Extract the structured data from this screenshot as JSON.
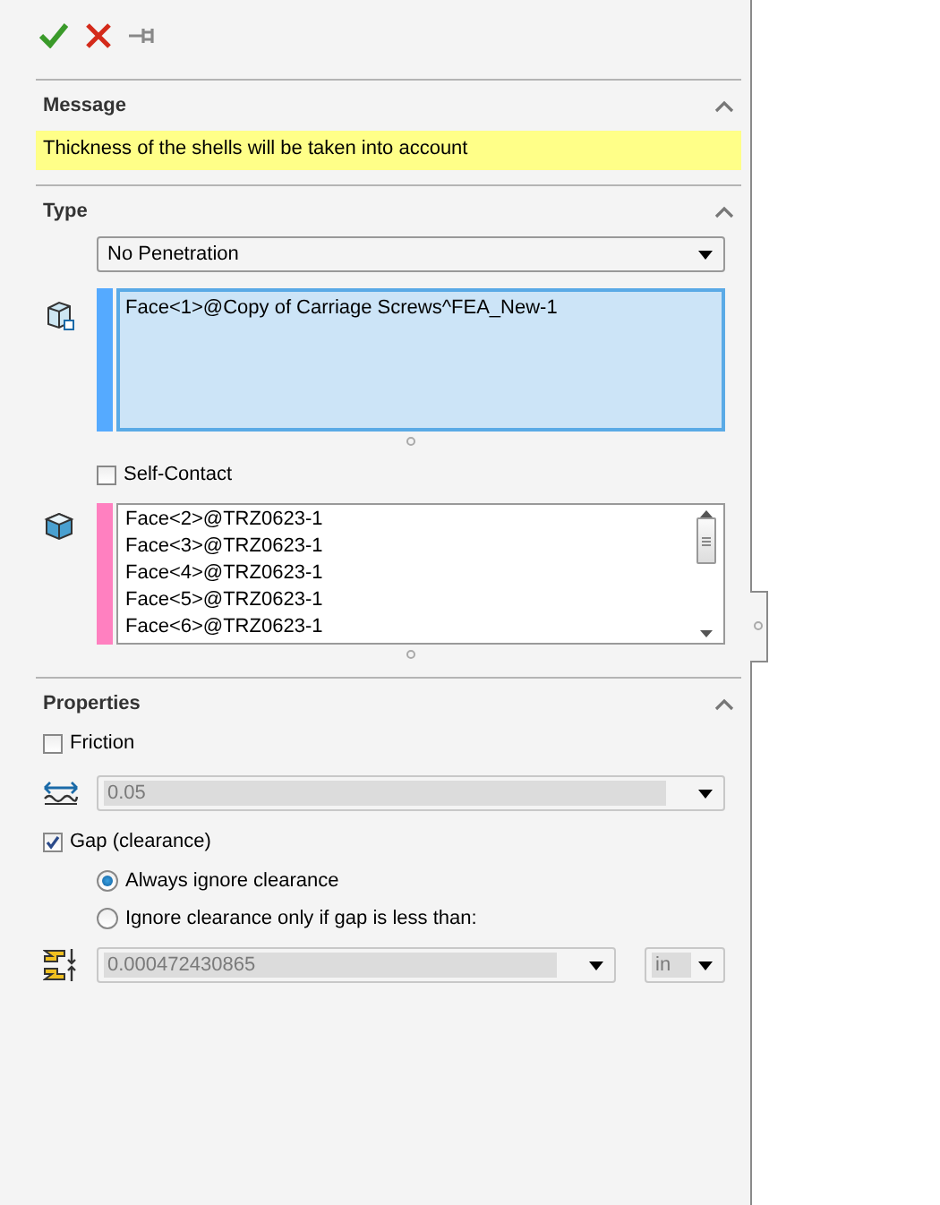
{
  "message": {
    "title": "Message",
    "expanded": true,
    "text": "Thickness of the shells will be taken into account"
  },
  "type": {
    "title": "Type",
    "expanded": true,
    "contact_type": "No Penetration",
    "selection_sets": [
      {
        "color": "#55aaff",
        "focused": true,
        "items": [
          "Face<1>@Copy of Carriage Screws^FEA_New-1"
        ]
      },
      {
        "color": "#ff80c0",
        "focused": false,
        "items": [
          "Face<2>@TRZ0623-1",
          "Face<3>@TRZ0623-1",
          "Face<4>@TRZ0623-1",
          "Face<5>@TRZ0623-1",
          "Face<6>@TRZ0623-1"
        ]
      }
    ],
    "self_contact": {
      "label": "Self-Contact",
      "checked": false
    }
  },
  "properties": {
    "title": "Properties",
    "expanded": true,
    "friction": {
      "label": "Friction",
      "checked": false,
      "value": "0.05",
      "disabled": true
    },
    "gap": {
      "label": "Gap (clearance)",
      "checked": true,
      "options": [
        {
          "label": "Always ignore clearance",
          "selected": true
        },
        {
          "label": "Ignore clearance only if gap is less than:",
          "selected": false
        }
      ],
      "value": "0.000472430865",
      "disabled": true,
      "unit": "in"
    }
  }
}
